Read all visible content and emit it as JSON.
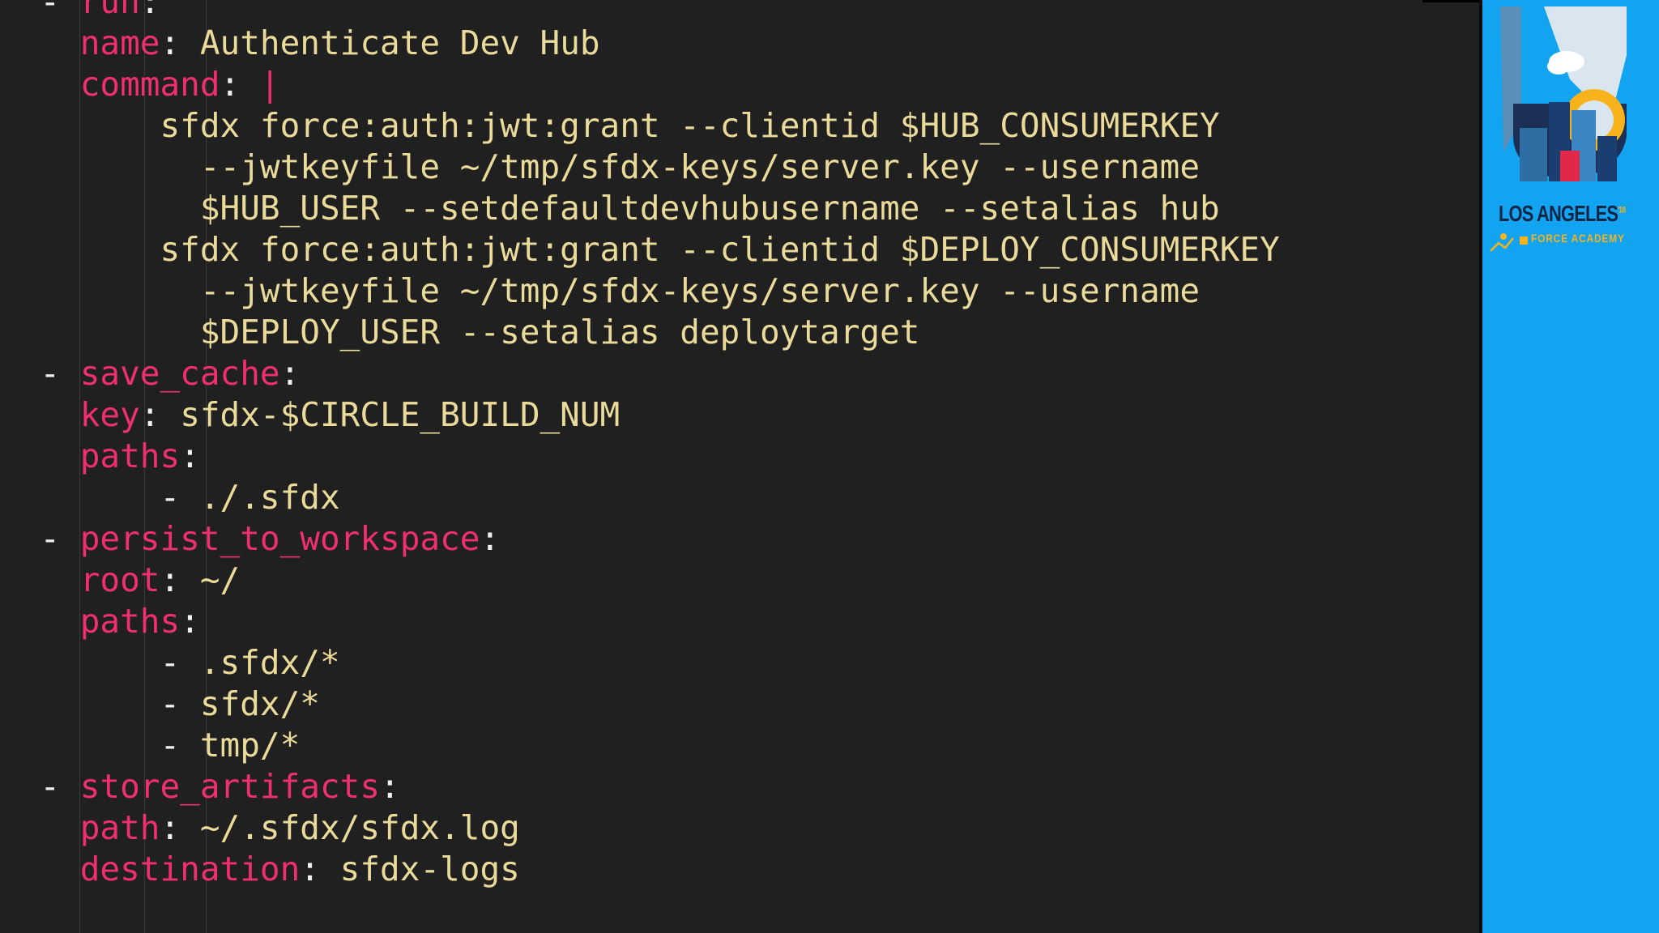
{
  "editor": {
    "lines": [
      {
        "indent": "  ",
        "dash": "- ",
        "key": "run",
        "sep": ":",
        "value": ""
      },
      {
        "indent": "    ",
        "dash": "",
        "key": "name",
        "sep": ": ",
        "value": "Authenticate Dev Hub"
      },
      {
        "indent": "    ",
        "dash": "",
        "key": "command",
        "sep": ": ",
        "value": "",
        "pipe": "|"
      },
      {
        "indent": "        ",
        "dash": "",
        "key": "",
        "sep": "",
        "value": "sfdx force:auth:jwt:grant --clientid $HUB_CONSUMERKEY"
      },
      {
        "indent": "          ",
        "dash": "",
        "key": "",
        "sep": "",
        "value": "--jwtkeyfile ~/tmp/sfdx-keys/server.key --username"
      },
      {
        "indent": "          ",
        "dash": "",
        "key": "",
        "sep": "",
        "value": "$HUB_USER --setdefaultdevhubusername --setalias hub"
      },
      {
        "indent": "        ",
        "dash": "",
        "key": "",
        "sep": "",
        "value": "sfdx force:auth:jwt:grant --clientid $DEPLOY_CONSUMERKEY"
      },
      {
        "indent": "          ",
        "dash": "",
        "key": "",
        "sep": "",
        "value": "--jwtkeyfile ~/tmp/sfdx-keys/server.key --username"
      },
      {
        "indent": "          ",
        "dash": "",
        "key": "",
        "sep": "",
        "value": "$DEPLOY_USER --setalias deploytarget"
      },
      {
        "indent": "  ",
        "dash": "- ",
        "key": "save_cache",
        "sep": ":",
        "value": ""
      },
      {
        "indent": "    ",
        "dash": "",
        "key": "key",
        "sep": ": ",
        "value": "sfdx-$CIRCLE_BUILD_NUM"
      },
      {
        "indent": "    ",
        "dash": "",
        "key": "paths",
        "sep": ":",
        "value": ""
      },
      {
        "indent": "        ",
        "dash": "- ",
        "key": "",
        "sep": "",
        "value": "./.sfdx"
      },
      {
        "indent": "  ",
        "dash": "- ",
        "key": "persist_to_workspace",
        "sep": ":",
        "value": ""
      },
      {
        "indent": "    ",
        "dash": "",
        "key": "root",
        "sep": ": ",
        "value": "~/"
      },
      {
        "indent": "    ",
        "dash": "",
        "key": "paths",
        "sep": ":",
        "value": ""
      },
      {
        "indent": "        ",
        "dash": "- ",
        "key": "",
        "sep": "",
        "value": ".sfdx/*"
      },
      {
        "indent": "        ",
        "dash": "- ",
        "key": "",
        "sep": "",
        "value": "sfdx/*"
      },
      {
        "indent": "        ",
        "dash": "- ",
        "key": "",
        "sep": "",
        "value": "tmp/*"
      },
      {
        "indent": "  ",
        "dash": "- ",
        "key": "store_artifacts",
        "sep": ":",
        "value": ""
      },
      {
        "indent": "    ",
        "dash": "",
        "key": "path",
        "sep": ": ",
        "value": "~/.sfdx/sfdx.log"
      },
      {
        "indent": "    ",
        "dash": "",
        "key": "destination",
        "sep": ": ",
        "value": "sfdx-logs"
      }
    ],
    "colors": {
      "background": "#202020",
      "key": "#ef2f6e",
      "value": "#eadb9a",
      "punctuation": "#f0f0f0"
    }
  },
  "sidebar": {
    "background": "#12a4f0",
    "logo": {
      "title": "LOS ANGELES",
      "superscript": "'18",
      "subtitle": "FORCE ACADEMY",
      "icon": "los-angeles-skyline-logo-icon"
    }
  }
}
